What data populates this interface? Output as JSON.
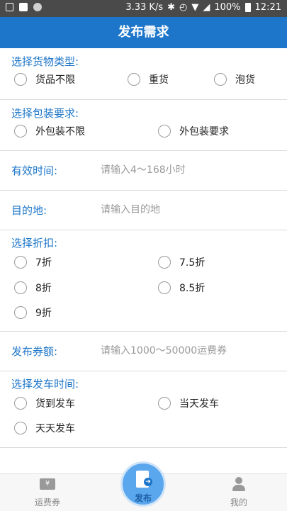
{
  "status_bar": {
    "speed": "3.33 K/s",
    "battery": "100%",
    "time": "12:21"
  },
  "header": {
    "title": "发布需求"
  },
  "cargo_type": {
    "title": "选择货物类型:",
    "options": [
      "货品不限",
      "重货",
      "泡货"
    ]
  },
  "packaging": {
    "title": "选择包装要求:",
    "options": [
      "外包装不限",
      "外包装要求"
    ]
  },
  "valid_time": {
    "label": "有效时间:",
    "placeholder": "请输入4～168小时"
  },
  "destination": {
    "label": "目的地:",
    "placeholder": "请输入目的地"
  },
  "discount": {
    "title": "选择折扣:",
    "options": [
      "7折",
      "7.5折",
      "8折",
      "8.5折",
      "9折"
    ]
  },
  "coupon": {
    "label": "发布券额:",
    "placeholder": "请输入1000～50000运费券"
  },
  "departure": {
    "title": "选择发车时间:",
    "options": [
      "货到发车",
      "当天发车",
      "天天发车"
    ]
  },
  "tabbar": {
    "coupon_label": "运费券",
    "publish_label": "发布",
    "mine_label": "我的",
    "coupon_icon_char": "¥"
  }
}
